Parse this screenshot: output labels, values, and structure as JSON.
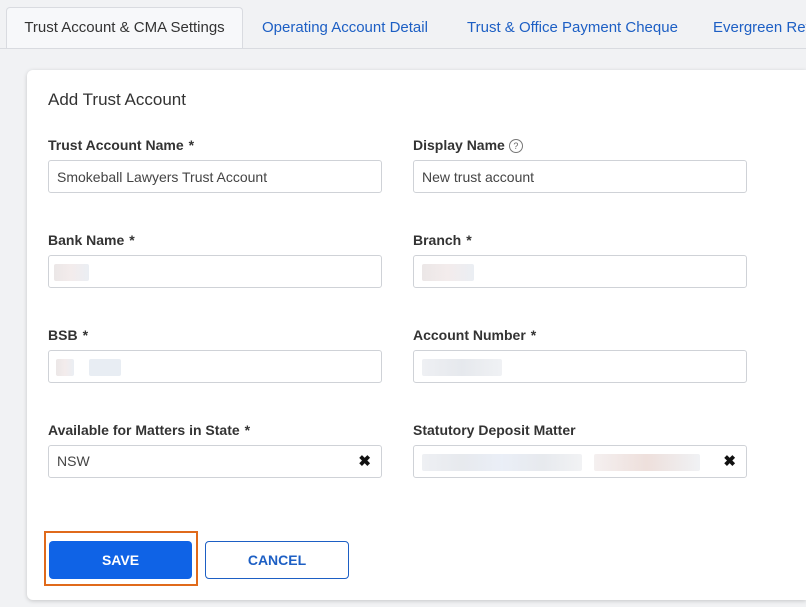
{
  "tabs": [
    {
      "label": "Trust Account & CMA Settings"
    },
    {
      "label": "Operating Account Detail"
    },
    {
      "label": "Trust & Office Payment Cheque"
    },
    {
      "label": "Evergreen Ret"
    }
  ],
  "form": {
    "title": "Add Trust Account",
    "required_marker": "*",
    "help_glyph": "?",
    "clear_glyph": "✖",
    "trust_account_name": {
      "label": "Trust Account Name",
      "value": "Smokeball Lawyers Trust Account"
    },
    "display_name": {
      "label": "Display Name",
      "value": "New trust account"
    },
    "bank_name": {
      "label": "Bank Name"
    },
    "branch": {
      "label": "Branch"
    },
    "bsb": {
      "label": "BSB"
    },
    "account_number": {
      "label": "Account Number"
    },
    "state": {
      "label": "Available for Matters in State",
      "value": "NSW"
    },
    "statutory_deposit_matter": {
      "label": "Statutory Deposit Matter"
    }
  },
  "buttons": {
    "save": "SAVE",
    "cancel": "CANCEL"
  },
  "colors": {
    "accent": "#0f63e6",
    "highlight": "#e06a1b"
  }
}
